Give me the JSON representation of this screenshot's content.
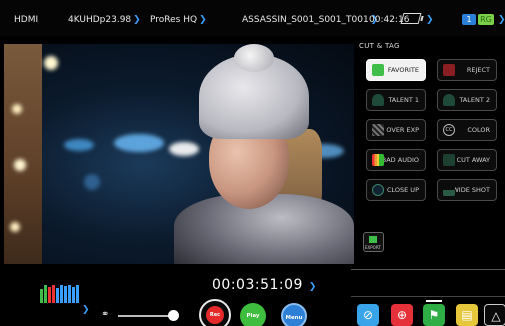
{
  "topbar": {
    "input": "HDMI",
    "format": "4KUHDp23.98",
    "codec": "ProRes HQ",
    "filename": "ASSASSIN_S001_S001_T001",
    "time_remaining": "00:42:16",
    "channel_badge_1": "1",
    "channel_badge_2": "RG"
  },
  "panel": {
    "title": "CUT & TAG",
    "tags": [
      {
        "label": "FAVORITE",
        "icon": "thumbs-up-icon",
        "active": true
      },
      {
        "label": "REJECT",
        "icon": "thumbs-down-icon",
        "active": false
      },
      {
        "label": "TALENT 1",
        "icon": "person-icon",
        "active": false
      },
      {
        "label": "TALENT 2",
        "icon": "person-icon",
        "active": false
      },
      {
        "label": "OVER EXP",
        "icon": "zebra-icon",
        "active": false
      },
      {
        "label": "COLOR",
        "icon": "cc-icon",
        "active": false
      },
      {
        "label": "BAD AUDIO",
        "icon": "audio-meter-icon",
        "active": false
      },
      {
        "label": "CUT AWAY",
        "icon": "cutaway-icon",
        "active": false
      },
      {
        "label": "CLOSE UP",
        "icon": "eye-icon",
        "active": false
      },
      {
        "label": "WIDE SHOT",
        "icon": "landscape-icon",
        "active": false
      }
    ],
    "export_label": "EXPORT"
  },
  "bottom": {
    "timecode": "00:03:51:09",
    "rec_label": "Rec",
    "play_label": "Play",
    "menu_label": "Menu"
  },
  "colors": {
    "accent": "#3aa0ff",
    "rec": "#e42a2a",
    "play": "#3ebd3e",
    "menu": "#2e7fd6"
  }
}
